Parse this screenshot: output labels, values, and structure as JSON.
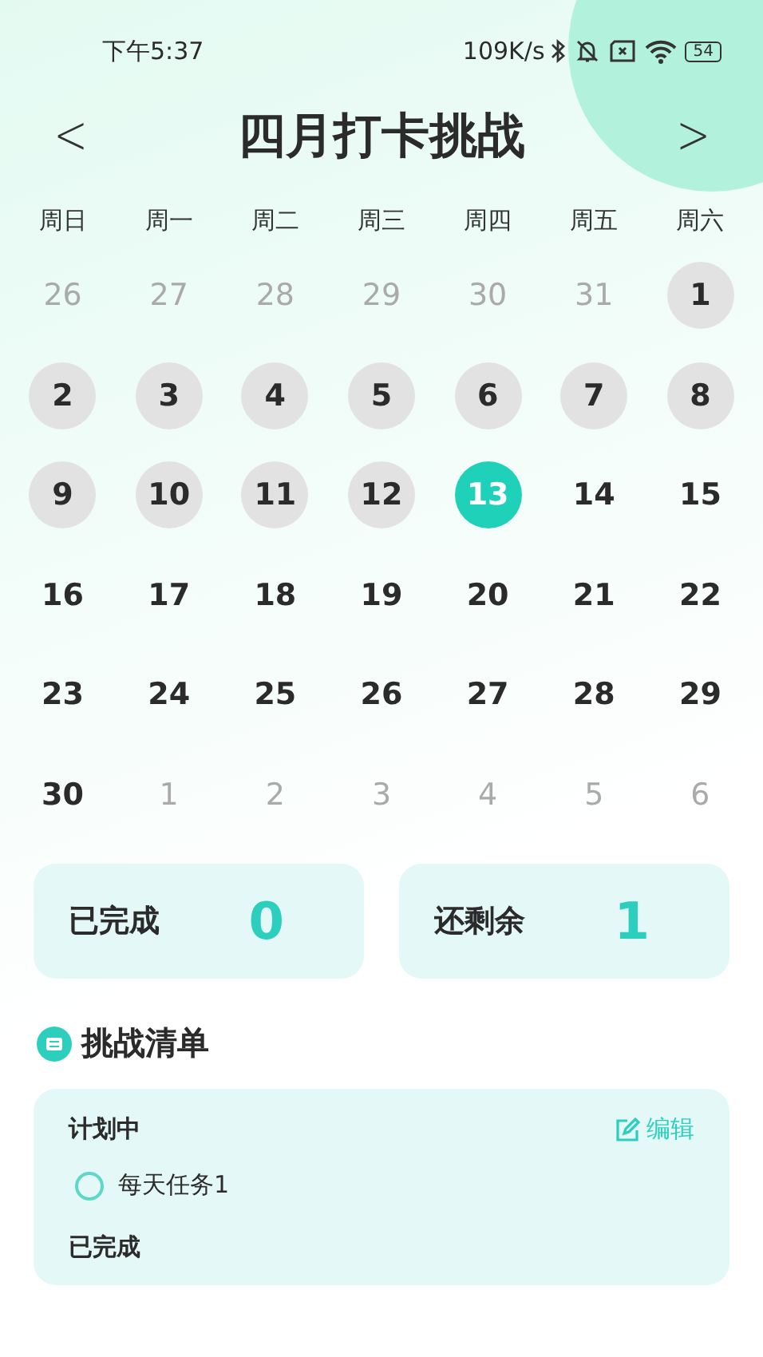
{
  "status_bar": {
    "time": "下午5:37",
    "speed": "109K/s",
    "battery": "54"
  },
  "header": {
    "prev": "<",
    "title": "四月打卡挑战",
    "next": ">"
  },
  "weekdays": [
    "周日",
    "周一",
    "周二",
    "周三",
    "周四",
    "周五",
    "周六"
  ],
  "days": [
    {
      "label": "26",
      "in_month": false,
      "marked": false,
      "selected": false
    },
    {
      "label": "27",
      "in_month": false,
      "marked": false,
      "selected": false
    },
    {
      "label": "28",
      "in_month": false,
      "marked": false,
      "selected": false
    },
    {
      "label": "29",
      "in_month": false,
      "marked": false,
      "selected": false
    },
    {
      "label": "30",
      "in_month": false,
      "marked": false,
      "selected": false
    },
    {
      "label": "31",
      "in_month": false,
      "marked": false,
      "selected": false
    },
    {
      "label": "1",
      "in_month": true,
      "marked": true,
      "selected": false
    },
    {
      "label": "2",
      "in_month": true,
      "marked": true,
      "selected": false
    },
    {
      "label": "3",
      "in_month": true,
      "marked": true,
      "selected": false
    },
    {
      "label": "4",
      "in_month": true,
      "marked": true,
      "selected": false
    },
    {
      "label": "5",
      "in_month": true,
      "marked": true,
      "selected": false
    },
    {
      "label": "6",
      "in_month": true,
      "marked": true,
      "selected": false
    },
    {
      "label": "7",
      "in_month": true,
      "marked": true,
      "selected": false
    },
    {
      "label": "8",
      "in_month": true,
      "marked": true,
      "selected": false
    },
    {
      "label": "9",
      "in_month": true,
      "marked": true,
      "selected": false
    },
    {
      "label": "10",
      "in_month": true,
      "marked": true,
      "selected": false
    },
    {
      "label": "11",
      "in_month": true,
      "marked": true,
      "selected": false
    },
    {
      "label": "12",
      "in_month": true,
      "marked": true,
      "selected": false
    },
    {
      "label": "13",
      "in_month": true,
      "marked": false,
      "selected": true
    },
    {
      "label": "14",
      "in_month": true,
      "marked": false,
      "selected": false
    },
    {
      "label": "15",
      "in_month": true,
      "marked": false,
      "selected": false
    },
    {
      "label": "16",
      "in_month": true,
      "marked": false,
      "selected": false
    },
    {
      "label": "17",
      "in_month": true,
      "marked": false,
      "selected": false
    },
    {
      "label": "18",
      "in_month": true,
      "marked": false,
      "selected": false
    },
    {
      "label": "19",
      "in_month": true,
      "marked": false,
      "selected": false
    },
    {
      "label": "20",
      "in_month": true,
      "marked": false,
      "selected": false
    },
    {
      "label": "21",
      "in_month": true,
      "marked": false,
      "selected": false
    },
    {
      "label": "22",
      "in_month": true,
      "marked": false,
      "selected": false
    },
    {
      "label": "23",
      "in_month": true,
      "marked": false,
      "selected": false
    },
    {
      "label": "24",
      "in_month": true,
      "marked": false,
      "selected": false
    },
    {
      "label": "25",
      "in_month": true,
      "marked": false,
      "selected": false
    },
    {
      "label": "26",
      "in_month": true,
      "marked": false,
      "selected": false
    },
    {
      "label": "27",
      "in_month": true,
      "marked": false,
      "selected": false
    },
    {
      "label": "28",
      "in_month": true,
      "marked": false,
      "selected": false
    },
    {
      "label": "29",
      "in_month": true,
      "marked": false,
      "selected": false
    },
    {
      "label": "30",
      "in_month": true,
      "marked": false,
      "selected": false
    },
    {
      "label": "1",
      "in_month": false,
      "marked": false,
      "selected": false
    },
    {
      "label": "2",
      "in_month": false,
      "marked": false,
      "selected": false
    },
    {
      "label": "3",
      "in_month": false,
      "marked": false,
      "selected": false
    },
    {
      "label": "4",
      "in_month": false,
      "marked": false,
      "selected": false
    },
    {
      "label": "5",
      "in_month": false,
      "marked": false,
      "selected": false
    },
    {
      "label": "6",
      "in_month": false,
      "marked": false,
      "selected": false
    }
  ],
  "stats": [
    {
      "label": "已完成",
      "value": "0"
    },
    {
      "label": "还剩余",
      "value": "1"
    }
  ],
  "challenge_list": {
    "title": "挑战清单",
    "planned_heading": "计划中",
    "edit": "编辑",
    "tasks": [
      {
        "name": "每天任务1",
        "checked": false
      }
    ],
    "done_heading": "已完成"
  }
}
